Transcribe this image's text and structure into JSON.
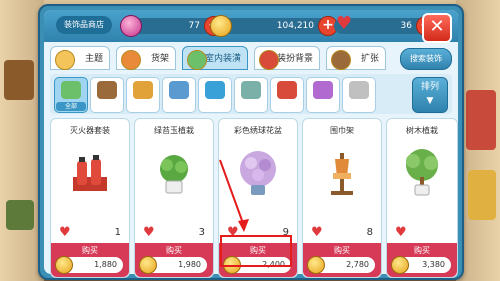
{
  "header": {
    "shop_title": "装饰品商店",
    "gems": "77",
    "coins": "104,210",
    "hearts": "36",
    "close": "✕"
  },
  "tabs": [
    {
      "label": "主题"
    },
    {
      "label": "货架"
    },
    {
      "label": "室内装潢"
    },
    {
      "label": "装扮背景"
    },
    {
      "label": "扩张"
    }
  ],
  "search_label": "搜索装饰",
  "subcategories": [
    {
      "label": "全部",
      "color": "#6cc06a"
    },
    {
      "label": "",
      "color": "#9b6a3a"
    },
    {
      "label": "",
      "color": "#e2a23a"
    },
    {
      "label": "",
      "color": "#5a9ad0"
    },
    {
      "label": "",
      "color": "#3aa0d8"
    },
    {
      "label": "",
      "color": "#7ab0a8"
    },
    {
      "label": "",
      "color": "#d84a3a"
    },
    {
      "label": "",
      "color": "#b06ad0"
    },
    {
      "label": "",
      "color": "#c0c0c0"
    }
  ],
  "sort_label": "排列",
  "items": [
    {
      "name": "灭火器套装",
      "count": "1",
      "buy": "购买",
      "price": "1,880"
    },
    {
      "name": "绿苔玉植栽",
      "count": "3",
      "buy": "购买",
      "price": "1,980"
    },
    {
      "name": "彩色绣球花盆",
      "count": "9",
      "buy": "购买",
      "price": "2,400"
    },
    {
      "name": "围巾架",
      "count": "8",
      "buy": "购买",
      "price": "2,780"
    },
    {
      "name": "树木植栽",
      "count": "",
      "buy": "购买",
      "price": "3,380"
    }
  ],
  "colors": {
    "accent": "#3b8fb5",
    "buy": "#d63a57",
    "highlight": "#e41c1c"
  }
}
